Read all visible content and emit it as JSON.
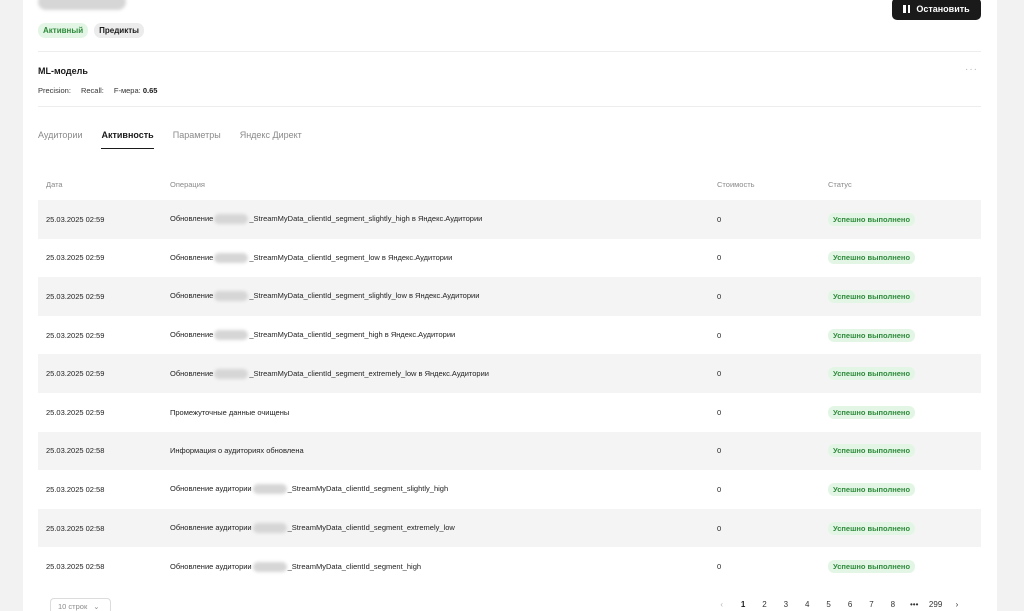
{
  "header": {
    "badge_active": "Активный",
    "badge_predict": "Предикты",
    "stop_label": "Остановить"
  },
  "model": {
    "title": "ML-модель",
    "precision_label": "Precision:",
    "recall_label": "Recall:",
    "fmeasure_label": "F-мера:",
    "fmeasure_value": "0.65",
    "more_icon": "···"
  },
  "tabs": [
    {
      "label": "Аудитории"
    },
    {
      "label": "Активность"
    },
    {
      "label": "Параметры"
    },
    {
      "label": "Яндекс Директ"
    }
  ],
  "table": {
    "headers": {
      "date": "Дата",
      "operation": "Операция",
      "cost": "Стоимость",
      "status": "Статус"
    },
    "rows": [
      {
        "date": "25.03.2025 02:59",
        "op_prefix": "Обновление",
        "op_suffix": "_StreamMyData_clientId_segment_slightly_high в Яндекс.Аудитории",
        "cost": "0",
        "status": "Успешно выполнено"
      },
      {
        "date": "25.03.2025 02:59",
        "op_prefix": "Обновление",
        "op_suffix": "_StreamMyData_clientId_segment_low в Яндекс.Аудитории",
        "cost": "0",
        "status": "Успешно выполнено"
      },
      {
        "date": "25.03.2025 02:59",
        "op_prefix": "Обновление",
        "op_suffix": "_StreamMyData_clientId_segment_slightly_low в Яндекс.Аудитории",
        "cost": "0",
        "status": "Успешно выполнено"
      },
      {
        "date": "25.03.2025 02:59",
        "op_prefix": "Обновление",
        "op_suffix": "_StreamMyData_clientId_segment_high в Яндекс.Аудитории",
        "cost": "0",
        "status": "Успешно выполнено"
      },
      {
        "date": "25.03.2025 02:59",
        "op_prefix": "Обновление",
        "op_suffix": "_StreamMyData_clientId_segment_extremely_low в Яндекс.Аудитории",
        "cost": "0",
        "status": "Успешно выполнено"
      },
      {
        "date": "25.03.2025 02:59",
        "op_prefix": "Промежуточные данные очищены",
        "op_suffix": "",
        "cost": "0",
        "status": "Успешно выполнено"
      },
      {
        "date": "25.03.2025 02:58",
        "op_prefix": "Информация о аудиториях обновлена",
        "op_suffix": "",
        "cost": "0",
        "status": "Успешно выполнено"
      },
      {
        "date": "25.03.2025 02:58",
        "op_prefix": "Обновление аудитории",
        "op_suffix": "_StreamMyData_clientId_segment_slightly_high",
        "cost": "0",
        "status": "Успешно выполнено"
      },
      {
        "date": "25.03.2025 02:58",
        "op_prefix": "Обновление аудитории",
        "op_suffix": "_StreamMyData_clientId_segment_extremely_low",
        "cost": "0",
        "status": "Успешно выполнено"
      },
      {
        "date": "25.03.2025 02:58",
        "op_prefix": "Обновление аудитории",
        "op_suffix": "_StreamMyData_clientId_segment_high",
        "cost": "0",
        "status": "Успешно выполнено"
      }
    ]
  },
  "footer": {
    "rows_per_page": "10 строк",
    "pages": [
      "1",
      "2",
      "3",
      "4",
      "5",
      "6",
      "7",
      "8",
      "•••",
      "299"
    ],
    "current_page": "1"
  }
}
